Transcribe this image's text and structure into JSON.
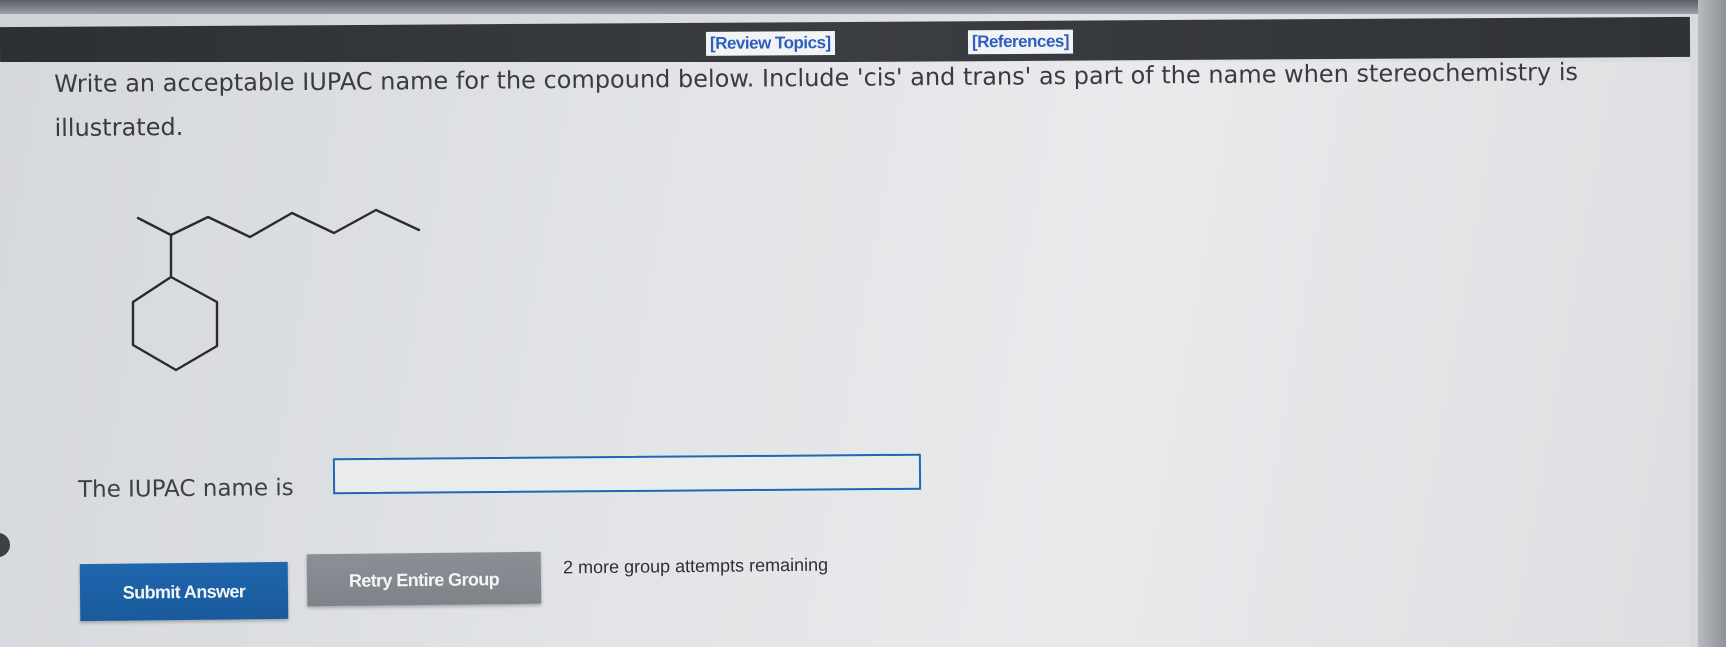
{
  "header": {
    "review_topics": "[Review Topics]",
    "references": "[References]"
  },
  "question": {
    "text": "Write an acceptable IUPAC name for the compound below. Include 'cis' and trans' as part of the name when stereochemistry is illustrated."
  },
  "answer": {
    "label": "The IUPAC name is",
    "value": "",
    "placeholder": ""
  },
  "actions": {
    "submit_label": "Submit Answer",
    "retry_label": "Retry Entire Group",
    "attempts_text": "2 more group attempts remaining"
  },
  "colors": {
    "link": "#2c5fbf",
    "submit_bg": "#1f66ad",
    "retry_bg": "#8c9096",
    "input_border": "#1f66b8"
  }
}
